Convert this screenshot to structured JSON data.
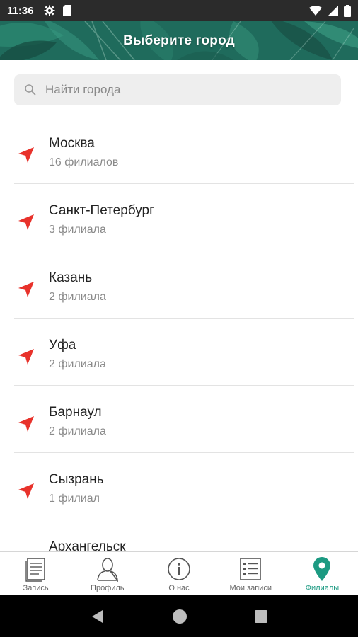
{
  "status_bar": {
    "time": "11:36"
  },
  "header": {
    "title": "Выберите город"
  },
  "search": {
    "placeholder": "Найти города",
    "value": ""
  },
  "cities": [
    {
      "name": "Москва",
      "count": "16 филиалов"
    },
    {
      "name": "Санкт-Петербург",
      "count": "3 филиала"
    },
    {
      "name": "Казань",
      "count": "2 филиала"
    },
    {
      "name": "Уфа",
      "count": "2 филиала"
    },
    {
      "name": "Барнаул",
      "count": "2 филиала"
    },
    {
      "name": "Сызрань",
      "count": "1 филиал"
    },
    {
      "name": "Архангельск",
      "count": ""
    }
  ],
  "bottom_nav": {
    "items": [
      {
        "label": "Запись",
        "icon": "document-icon"
      },
      {
        "label": "Профиль",
        "icon": "person-icon"
      },
      {
        "label": "О нас",
        "icon": "info-icon"
      },
      {
        "label": "Мои записи",
        "icon": "list-icon"
      },
      {
        "label": "Филиалы",
        "icon": "location-pin-icon",
        "active": true
      }
    ]
  },
  "colors": {
    "accent": "#1c9a82",
    "arrow": "#e8322b",
    "header_bg": "#1f6b5c"
  }
}
